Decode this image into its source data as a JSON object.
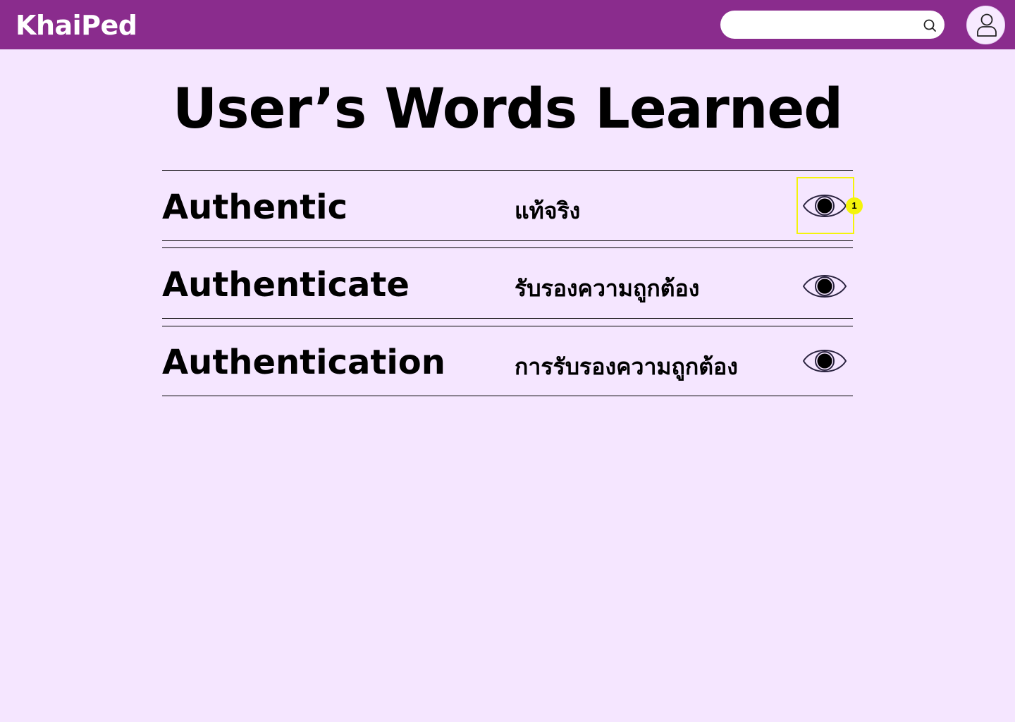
{
  "header": {
    "logo": "KhaiPed",
    "search": {
      "value": "",
      "placeholder": ""
    },
    "colors": {
      "bar": "#8a2c8d",
      "background": "#f5e6ff"
    }
  },
  "main": {
    "title": "User’s Words Learned",
    "words": [
      {
        "english": "Authentic",
        "thai": "แท้จริง"
      },
      {
        "english": "Authenticate",
        "thai": "รับรองความถูกต้อง"
      },
      {
        "english": "Authentication",
        "thai": "การรับรองความถูกต้อง"
      }
    ]
  },
  "annotation": {
    "label": "1",
    "color": "#f4f40a"
  }
}
